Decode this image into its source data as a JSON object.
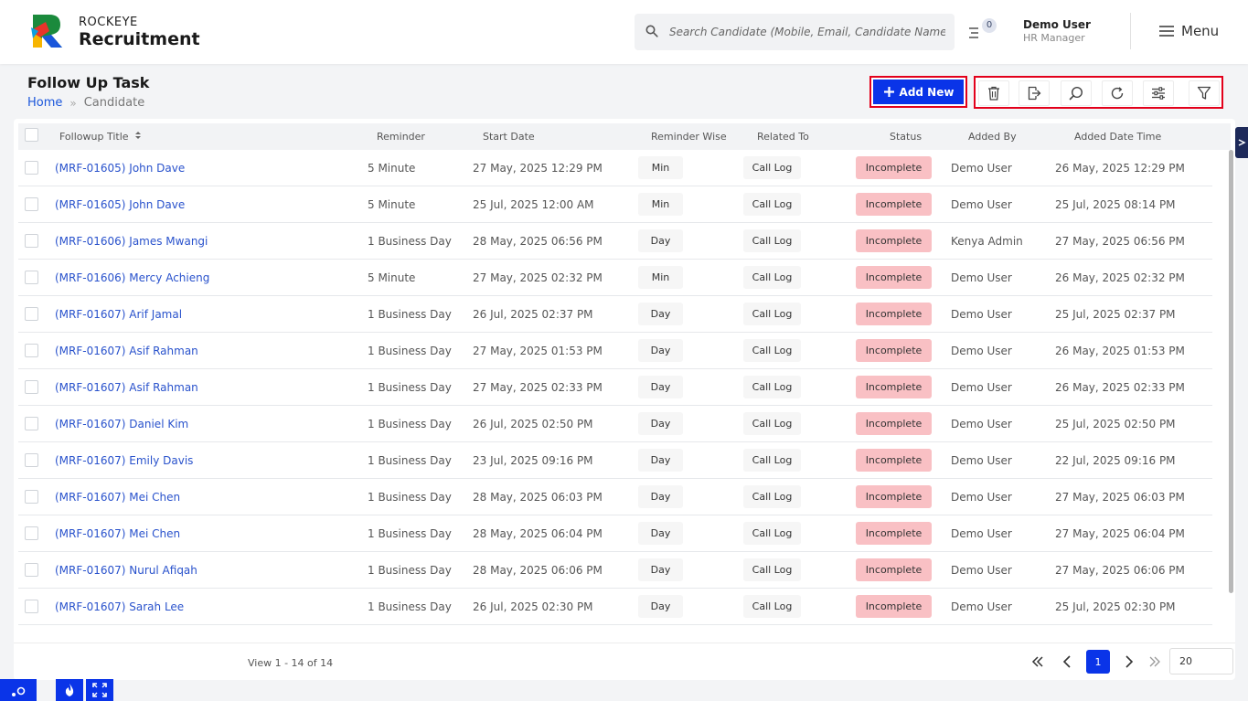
{
  "brand": {
    "top": "ROCKEYE",
    "main": "Recruitment"
  },
  "search": {
    "placeholder": "Search Candidate (Mobile, Email, Candidate Name)"
  },
  "notifications": {
    "count": "0"
  },
  "user": {
    "name": "Demo User",
    "role": "HR Manager"
  },
  "menu": {
    "label": "Menu"
  },
  "page": {
    "title": "Follow Up Task"
  },
  "breadcrumb": {
    "home": "Home",
    "current": "Candidate"
  },
  "toolbar": {
    "add_label": "Add New",
    "icons": [
      "trash-icon",
      "export-icon",
      "search-icon",
      "refresh-icon",
      "settings-sliders-icon",
      "filter-icon"
    ]
  },
  "columns": [
    "Followup Title",
    "Reminder",
    "Start Date",
    "Reminder Wise",
    "Related To",
    "Status",
    "Added By",
    "Added Date Time"
  ],
  "rows": [
    {
      "title": "(MRF-01605) John Dave",
      "reminder": "5 Minute",
      "start": "27 May, 2025 12:29 PM",
      "wise": "Min",
      "related": "Call Log",
      "status": "Incomplete",
      "added_by": "Demo User",
      "added_at": "26 May, 2025 12:29 PM"
    },
    {
      "title": "(MRF-01605) John Dave",
      "reminder": "5 Minute",
      "start": "25 Jul, 2025 12:00 AM",
      "wise": "Min",
      "related": "Call Log",
      "status": "Incomplete",
      "added_by": "Demo User",
      "added_at": "25 Jul, 2025 08:14 PM"
    },
    {
      "title": "(MRF-01606) James Mwangi",
      "reminder": "1 Business Day",
      "start": "28 May, 2025 06:56 PM",
      "wise": "Day",
      "related": "Call Log",
      "status": "Incomplete",
      "added_by": "Kenya Admin",
      "added_at": "27 May, 2025 06:56 PM"
    },
    {
      "title": "(MRF-01606) Mercy Achieng",
      "reminder": "5 Minute",
      "start": "27 May, 2025 02:32 PM",
      "wise": "Min",
      "related": "Call Log",
      "status": "Incomplete",
      "added_by": "Demo User",
      "added_at": "26 May, 2025 02:32 PM"
    },
    {
      "title": "(MRF-01607) Arif Jamal",
      "reminder": "1 Business Day",
      "start": "26 Jul, 2025 02:37 PM",
      "wise": "Day",
      "related": "Call Log",
      "status": "Incomplete",
      "added_by": "Demo User",
      "added_at": "25 Jul, 2025 02:37 PM"
    },
    {
      "title": "(MRF-01607) Asif Rahman",
      "reminder": "1 Business Day",
      "start": "27 May, 2025 01:53 PM",
      "wise": "Day",
      "related": "Call Log",
      "status": "Incomplete",
      "added_by": "Demo User",
      "added_at": "26 May, 2025 01:53 PM"
    },
    {
      "title": "(MRF-01607) Asif Rahman",
      "reminder": "1 Business Day",
      "start": "27 May, 2025 02:33 PM",
      "wise": "Day",
      "related": "Call Log",
      "status": "Incomplete",
      "added_by": "Demo User",
      "added_at": "26 May, 2025 02:33 PM"
    },
    {
      "title": "(MRF-01607) Daniel Kim",
      "reminder": "1 Business Day",
      "start": "26 Jul, 2025 02:50 PM",
      "wise": "Day",
      "related": "Call Log",
      "status": "Incomplete",
      "added_by": "Demo User",
      "added_at": "25 Jul, 2025 02:50 PM"
    },
    {
      "title": "(MRF-01607) Emily Davis",
      "reminder": "1 Business Day",
      "start": "23 Jul, 2025 09:16 PM",
      "wise": "Day",
      "related": "Call Log",
      "status": "Incomplete",
      "added_by": "Demo User",
      "added_at": "22 Jul, 2025 09:16 PM"
    },
    {
      "title": "(MRF-01607) Mei Chen",
      "reminder": "1 Business Day",
      "start": "28 May, 2025 06:03 PM",
      "wise": "Day",
      "related": "Call Log",
      "status": "Incomplete",
      "added_by": "Demo User",
      "added_at": "27 May, 2025 06:03 PM"
    },
    {
      "title": "(MRF-01607) Mei Chen",
      "reminder": "1 Business Day",
      "start": "28 May, 2025 06:04 PM",
      "wise": "Day",
      "related": "Call Log",
      "status": "Incomplete",
      "added_by": "Demo User",
      "added_at": "27 May, 2025 06:04 PM"
    },
    {
      "title": "(MRF-01607) Nurul Afiqah",
      "reminder": "1 Business Day",
      "start": "28 May, 2025 06:06 PM",
      "wise": "Day",
      "related": "Call Log",
      "status": "Incomplete",
      "added_by": "Demo User",
      "added_at": "27 May, 2025 06:06 PM"
    },
    {
      "title": "(MRF-01607) Sarah Lee",
      "reminder": "1 Business Day",
      "start": "26 Jul, 2025 02:30 PM",
      "wise": "Day",
      "related": "Call Log",
      "status": "Incomplete",
      "added_by": "Demo User",
      "added_at": "25 Jul, 2025 02:30 PM"
    }
  ],
  "pagination": {
    "view_text": "View 1 - 14 of 14",
    "current_page": "1",
    "page_size": "20"
  },
  "colors": {
    "accent": "#0a34e8",
    "highlight": "#e3001b",
    "status_incomplete": "#f9c0c4",
    "link": "#2952cc"
  }
}
